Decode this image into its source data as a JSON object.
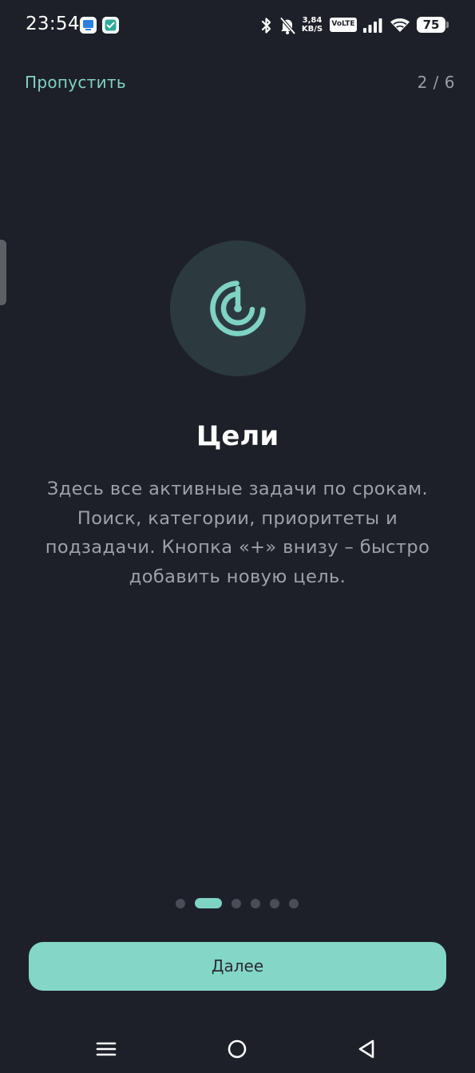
{
  "status_bar": {
    "time": "23:54",
    "net_speed_value": "3,84",
    "net_speed_unit": "KB/S",
    "volte": "VoLTE",
    "battery": "75",
    "icons": [
      "app-notification-icon",
      "check-notification-icon",
      "bluetooth-icon",
      "muted-bell-icon",
      "signal-icon",
      "wifi-icon",
      "battery-icon"
    ]
  },
  "header": {
    "skip_label": "Пропустить",
    "page_counter": "2 / 6"
  },
  "slide": {
    "icon": "target-icon",
    "title": "Цели",
    "description_lines": [
      "Здесь все активные задачи по срокам.",
      "Поиск, категории, приоритеты и",
      "подзадачи. Кнопка «+» внизу – быстро",
      "добавить новую цель."
    ]
  },
  "pager": {
    "total": 6,
    "current": 2
  },
  "footer": {
    "next_label": "Далее"
  },
  "navigation": {
    "buttons": [
      "menu-icon",
      "home-icon",
      "back-icon"
    ]
  },
  "colors": {
    "background": "#1e2029",
    "accent": "#7fd3c3",
    "button": "#84d6c6",
    "muted_text": "#9fa1aa",
    "icon_circle": "#2c3a3f"
  }
}
